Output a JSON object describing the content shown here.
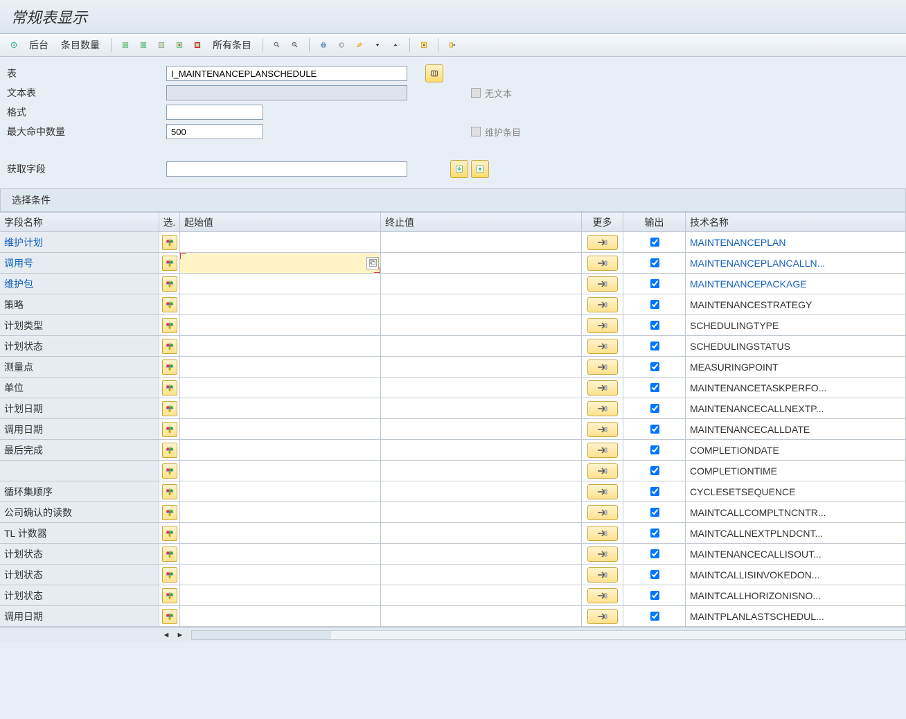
{
  "title": "常规表显示",
  "toolbar": {
    "background": "后台",
    "entry_count": "条目数量",
    "all_entries": "所有条目"
  },
  "form": {
    "table_label": "表",
    "table_value": "I_MAINTENANCEPLANSCHEDULE",
    "text_table_label": "文本表",
    "text_table_value": "",
    "no_text_label": "无文本",
    "format_label": "格式",
    "format_value": "",
    "max_hits_label": "最大命中数量",
    "max_hits_value": "500",
    "maintain_entries_label": "维护条目",
    "get_fields_label": "获取字段",
    "get_fields_value": ""
  },
  "section_header": "选择条件",
  "columns": {
    "name": "字段名称",
    "sel": "选.",
    "from": "起始值",
    "to": "终止值",
    "more": "更多",
    "out": "输出",
    "tech": "技术名称"
  },
  "rows": [
    {
      "name": "维护计划",
      "tech": "MAINTENANCEPLAN",
      "link": true,
      "out": true
    },
    {
      "name": "调用号",
      "tech": "MAINTENANCEPLANCALLN...",
      "link": true,
      "out": true,
      "active": true
    },
    {
      "name": "维护包",
      "tech": "MAINTENANCEPACKAGE",
      "link": true,
      "out": true
    },
    {
      "name": "策略",
      "tech": "MAINTENANCESTRATEGY",
      "link": false,
      "out": true
    },
    {
      "name": "计划类型",
      "tech": "SCHEDULINGTYPE",
      "link": false,
      "out": true
    },
    {
      "name": "计划状态",
      "tech": "SCHEDULINGSTATUS",
      "link": false,
      "out": true
    },
    {
      "name": "测量点",
      "tech": "MEASURINGPOINT",
      "link": false,
      "out": true
    },
    {
      "name": "单位",
      "tech": "MAINTENANCETASKPERFO...",
      "link": false,
      "out": true
    },
    {
      "name": "计划日期",
      "tech": "MAINTENANCECALLNEXTP...",
      "link": false,
      "out": true
    },
    {
      "name": "调用日期",
      "tech": "MAINTENANCECALLDATE",
      "link": false,
      "out": true
    },
    {
      "name": "最后完成",
      "tech": "COMPLETIONDATE",
      "link": false,
      "out": true
    },
    {
      "name": "",
      "tech": "COMPLETIONTIME",
      "link": false,
      "out": true
    },
    {
      "name": "循环集顺序",
      "tech": "CYCLESETSEQUENCE",
      "link": false,
      "out": true
    },
    {
      "name": "公司确认的读数",
      "tech": "MAINTCALLCOMPLTNCNTR...",
      "link": false,
      "out": true
    },
    {
      "name": "TL 计数器",
      "tech": "MAINTCALLNEXTPLNDCNT...",
      "link": false,
      "out": true
    },
    {
      "name": "计划状态",
      "tech": "MAINTENANCECALLISOUT...",
      "link": false,
      "out": true
    },
    {
      "name": "计划状态",
      "tech": "MAINTCALLISINVOKEDON...",
      "link": false,
      "out": true
    },
    {
      "name": "计划状态",
      "tech": "MAINTCALLHORIZONISNO...",
      "link": false,
      "out": true
    },
    {
      "name": "调用日期",
      "tech": "MAINTPLANLASTSCHEDUL...",
      "link": false,
      "out": true
    }
  ]
}
